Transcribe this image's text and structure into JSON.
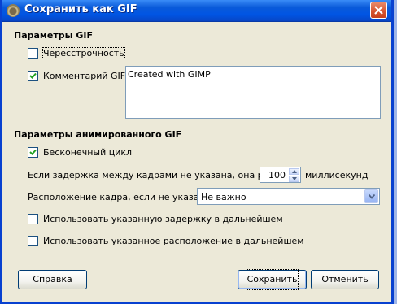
{
  "window": {
    "title": "Сохранить как GIF"
  },
  "gif_params": {
    "heading": "Параметры GIF",
    "interlace": {
      "label": "Чересстрочность",
      "checked": false
    },
    "comment": {
      "label": "Комментарий GIF:",
      "checked": true,
      "value": "Created with GIMP"
    }
  },
  "anim_params": {
    "heading": "Параметры анимированного GIF",
    "loop": {
      "label": "Бесконечный цикл",
      "checked": true
    },
    "delay": {
      "label": "Если задержка между кадрами не указана, она равна:",
      "value": "100",
      "unit": "миллисекунд"
    },
    "disposal": {
      "label": "Расположение кадра, если не указано:",
      "selected": "Не важно"
    },
    "use_delay": {
      "label": "Использовать указанную задержку в дальнейшем",
      "checked": false
    },
    "use_disposal": {
      "label": "Использовать указанное расположение в дальнейшем",
      "checked": false
    }
  },
  "buttons": {
    "help": "Справка",
    "save": "Сохранить",
    "cancel": "Отменить"
  },
  "colors": {
    "titlebar": "#0055e4",
    "dialog_bg": "#ece9d8",
    "check_mark": "#21a121"
  },
  "icons": {
    "title": "gimp-icon",
    "close": "close-icon"
  }
}
